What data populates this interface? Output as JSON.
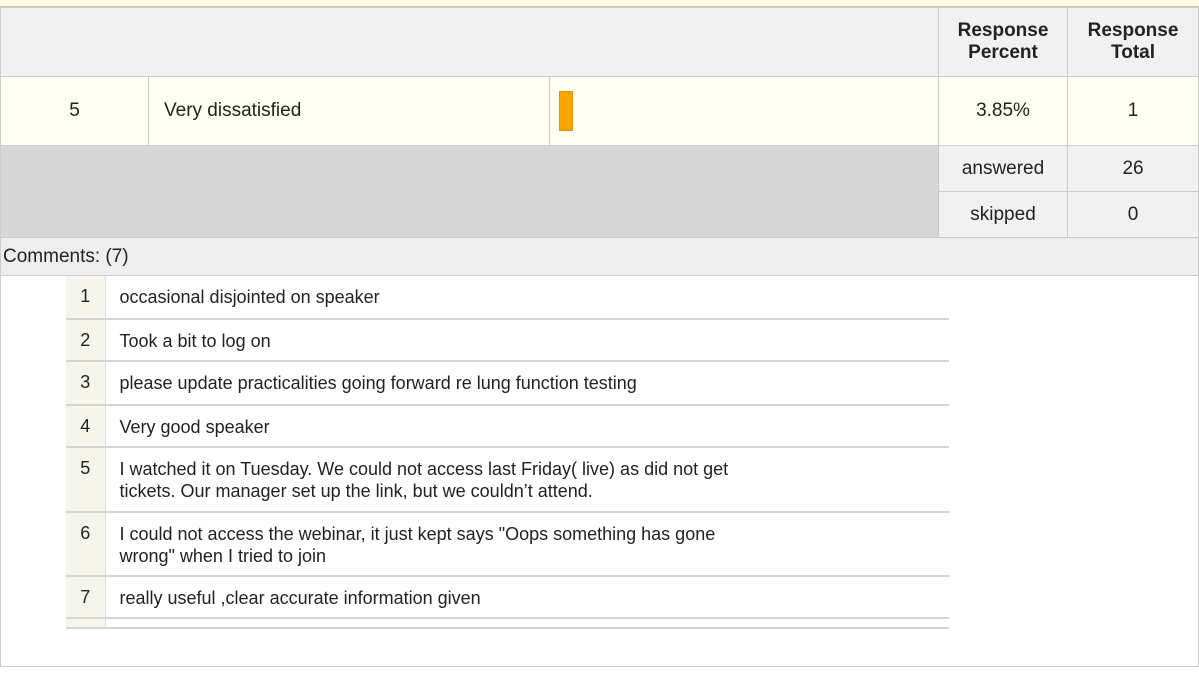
{
  "header": {
    "response_percent": "Response Percent",
    "response_total": "Response Total"
  },
  "row": {
    "number": "5",
    "label": "Very dissatisfied",
    "percent": "3.85%",
    "total": "1",
    "bar_fraction": 0.0385,
    "bar_color": "#ffa500"
  },
  "summary": {
    "answered_label": "answered",
    "answered_value": "26",
    "skipped_label": "skipped",
    "skipped_value": "0"
  },
  "comments": {
    "title": "Comments: (7)",
    "items": [
      {
        "num": "1",
        "text": "occasional disjointed on speaker"
      },
      {
        "num": "2",
        "text": "Took a bit to log on"
      },
      {
        "num": "3",
        "text": "please update practicalities going forward re lung function testing"
      },
      {
        "num": "4",
        "text": "Very good speaker"
      },
      {
        "num": "5",
        "text": "I watched it on Tuesday. We could not access last Friday( live) as did not get tickets. Our manager set up the link, but we couldn’t attend."
      },
      {
        "num": "6",
        "text": "I could not access the webinar, it just kept says \"Oops something has gone wrong\" when I tried to join"
      },
      {
        "num": "7",
        "text": "really useful ,clear accurate information given"
      }
    ]
  }
}
